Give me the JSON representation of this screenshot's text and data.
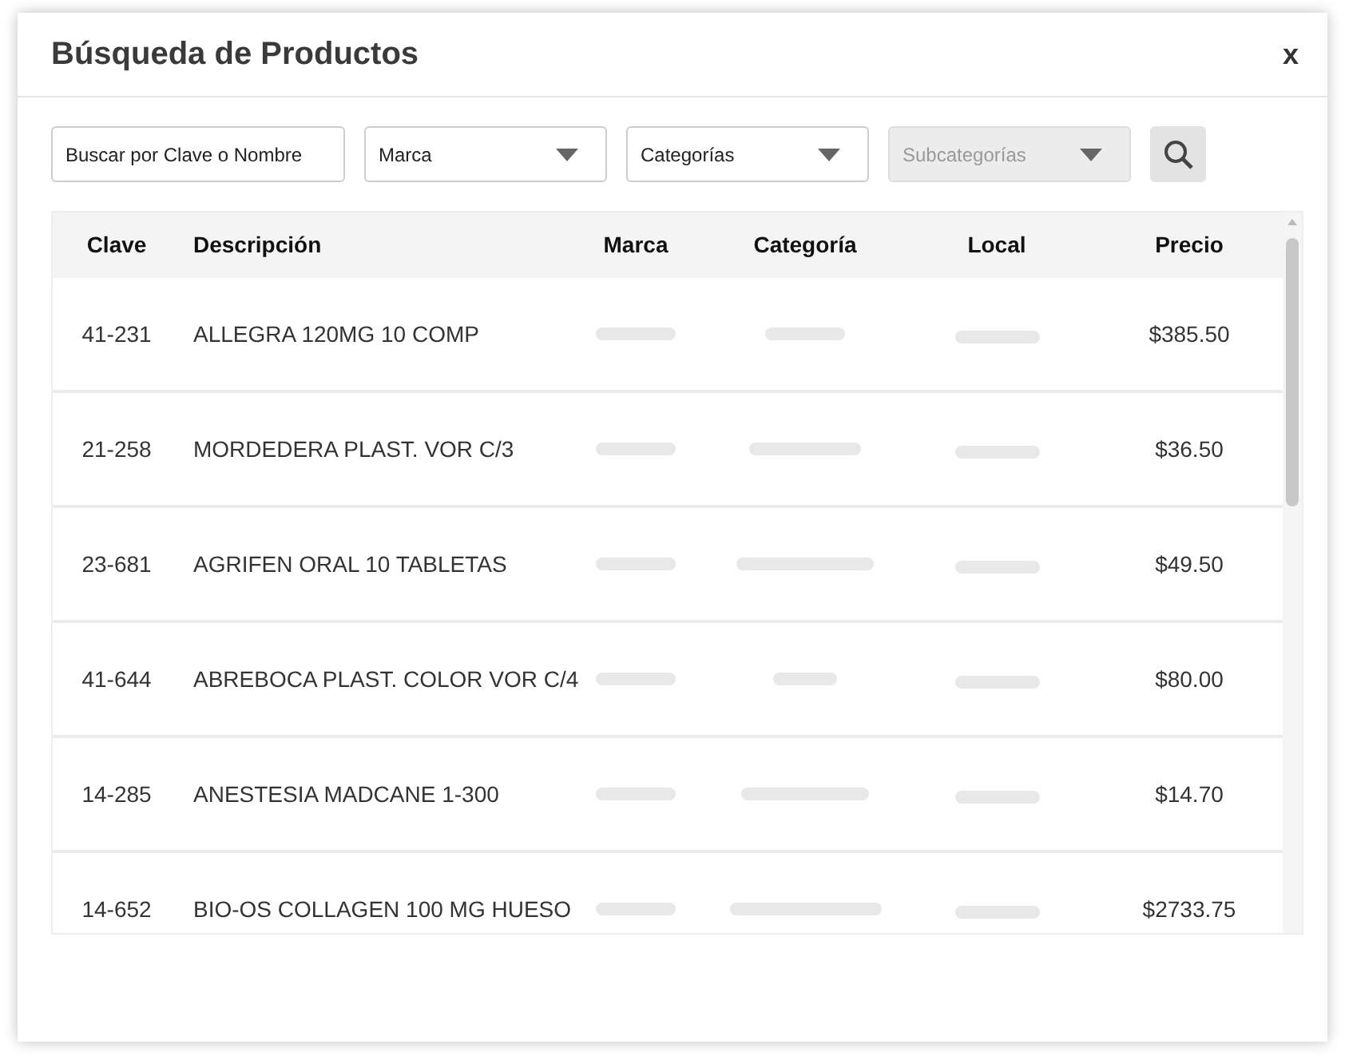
{
  "dialog": {
    "title": "Búsqueda de Productos",
    "close": "x"
  },
  "filters": {
    "search": {
      "placeholder": "Buscar por Clave o Nombre"
    },
    "dropdowns": [
      {
        "label": "Marca",
        "disabled": false
      },
      {
        "label": "Categorías",
        "disabled": false
      },
      {
        "label": "Subcategorías",
        "disabled": true
      }
    ]
  },
  "table": {
    "columns": [
      "Clave",
      "Descripción",
      "Marca",
      "Categoría",
      "Local",
      "Precio"
    ],
    "rows": [
      {
        "clave": "41-231",
        "descripcion": "ALLEGRA 120MG 10 COMP",
        "precio": "$385.50"
      },
      {
        "clave": "21-258",
        "descripcion": "MORDEDERA PLAST. VOR C/3",
        "precio": "$36.50"
      },
      {
        "clave": "23-681",
        "descripcion": "AGRIFEN ORAL 10 TABLETAS",
        "precio": "$49.50"
      },
      {
        "clave": "41-644",
        "descripcion": "ABREBOCA PLAST. COLOR VOR C/4",
        "precio": "$80.00"
      },
      {
        "clave": "14-285",
        "descripcion": "ANESTESIA MADCANE 1-300",
        "precio": "$14.70"
      },
      {
        "clave": "14-652",
        "descripcion": "BIO-OS COLLAGEN 100 MG HUESO",
        "precio": "$2733.75"
      }
    ]
  }
}
